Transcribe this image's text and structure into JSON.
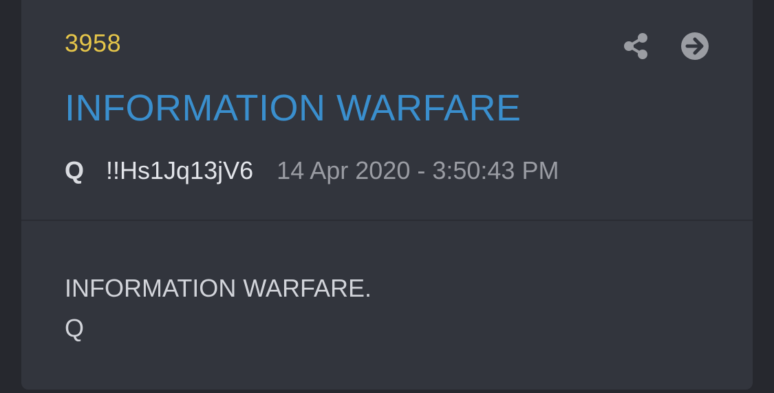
{
  "post": {
    "number": "3958",
    "title": "INFORMATION WARFARE",
    "author": "Q",
    "tripcode": "!!Hs1Jq13jV6",
    "timestamp": "14 Apr 2020 - 3:50:43 PM",
    "body_lines": [
      "INFORMATION WARFARE.",
      "Q"
    ]
  },
  "icons": {
    "share": "share-icon",
    "open": "arrow-right-circle-icon"
  },
  "colors": {
    "background": "#26282e",
    "card": "#32353d",
    "number": "#e6c64a",
    "title": "#3a8fce",
    "text": "#d2d4da",
    "muted": "#9a9ca3",
    "icon": "#9b9da3"
  }
}
